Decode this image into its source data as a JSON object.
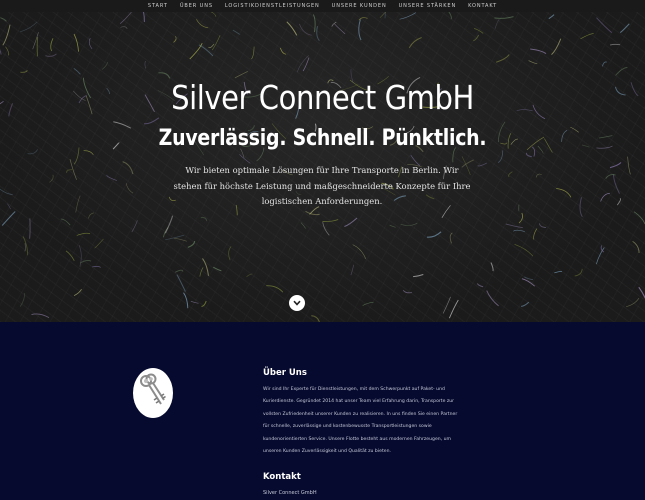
{
  "nav": {
    "items": [
      "START",
      "ÜBER UNS",
      "LOGISTIKDIENSTLEISTUNGEN",
      "UNSERE KUNDEN",
      "UNSERE STÄRKEN",
      "KONTAKT"
    ]
  },
  "hero": {
    "title": "Silver Connect GmbH",
    "subtitle": "Zuverlässig. Schnell. Pünktlich.",
    "text": "Wir bieten optimale Lösungen für Ihre Transporte in Berlin. Wir stehen für höchste Leistung und maßgeschneiderte Konzepte für Ihre logistischen Anforderungen."
  },
  "about": {
    "heading": "Über Uns",
    "text": "Wir sind Ihr Experte für Dienstleistungen, mit dem Schwerpunkt auf Paket- und Kurierdienste. Gegründet 2014 hat unser Team viel Erfahrung darin, Transporte zur vollsten Zufriedenheit unserer Kunden zu realisieren. In uns finden Sie einen Partner für schnelle, zuverlässige und kostenbewusste Transportleistungen sowie kundenorientierten Service. Unsere Flotte besteht aus modernen Fahrzeugen, um unseren Kunden Zuverlässigkeit und Qualität zu bieten."
  },
  "contact": {
    "heading": "Kontakt",
    "company": "Silver Connect GmbH"
  },
  "icons": {
    "scroll": "chevron-down-icon",
    "logo": "keys-icon"
  },
  "colors": {
    "section_background": "#060a2e",
    "hero_background": "#1b1b1b",
    "nav_background": "#1a1a1a"
  }
}
